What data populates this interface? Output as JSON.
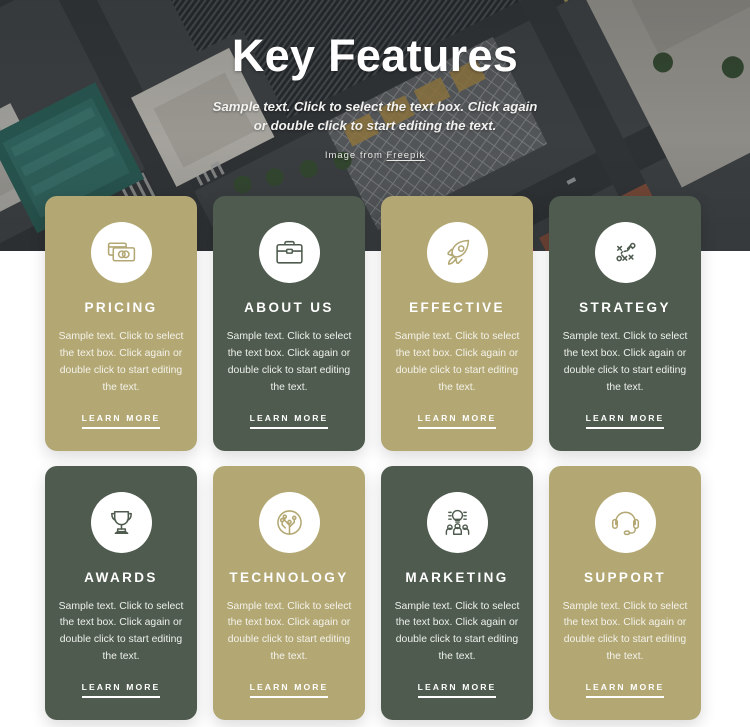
{
  "hero": {
    "title": "Key Features",
    "subtitle": "Sample text. Click to select the text box. Click again or double click to start editing the text.",
    "credit_prefix": "Image from",
    "credit_source": "Freepik",
    "background_image": "aerial-cityscape-photo"
  },
  "colors": {
    "khaki": "#b3a874",
    "green": "#4e5b4e",
    "card_text": "#f4f2ea",
    "title_text": "#ffffff",
    "icon_circle": "#ffffff",
    "page_background": "#ffffff"
  },
  "cards": [
    {
      "title": "PRICING",
      "text": "Sample text. Click to select the text box. Click again or double click to start editing the text.",
      "link_label": "LEARN MORE",
      "theme": "khaki",
      "icon": "credit-cards-icon"
    },
    {
      "title": "ABOUT US",
      "text": "Sample text. Click to select the text box. Click again or double click to start editing the text.",
      "link_label": "LEARN MORE",
      "theme": "green",
      "icon": "briefcase-icon"
    },
    {
      "title": "EFFECTIVE",
      "text": "Sample text. Click to select the text box. Click again or double click to start editing the text.",
      "link_label": "LEARN MORE",
      "theme": "khaki",
      "icon": "rocket-icon"
    },
    {
      "title": "STRATEGY",
      "text": "Sample text. Click to select the text box. Click again or double click to start editing the text.",
      "link_label": "LEARN MORE",
      "theme": "green",
      "icon": "playbook-strategy-icon"
    },
    {
      "title": "AWARDS",
      "text": "Sample text. Click to select the text box. Click again or double click to start editing the text.",
      "link_label": "LEARN MORE",
      "theme": "green",
      "icon": "trophy-icon"
    },
    {
      "title": "TECHNOLOGY",
      "text": "Sample text. Click to select the text box. Click again or double click to start editing the text.",
      "link_label": "LEARN MORE",
      "theme": "khaki",
      "icon": "circuit-chip-icon"
    },
    {
      "title": "MARKETING",
      "text": "Sample text. Click to select the text box. Click again or double click to start editing the text.",
      "link_label": "LEARN MORE",
      "theme": "green",
      "icon": "lightbulb-team-icon"
    },
    {
      "title": "SUPPORT",
      "text": "Sample text. Click to select the text box. Click again or double click to start editing the text.",
      "link_label": "LEARN MORE",
      "theme": "khaki",
      "icon": "headset-icon"
    }
  ]
}
